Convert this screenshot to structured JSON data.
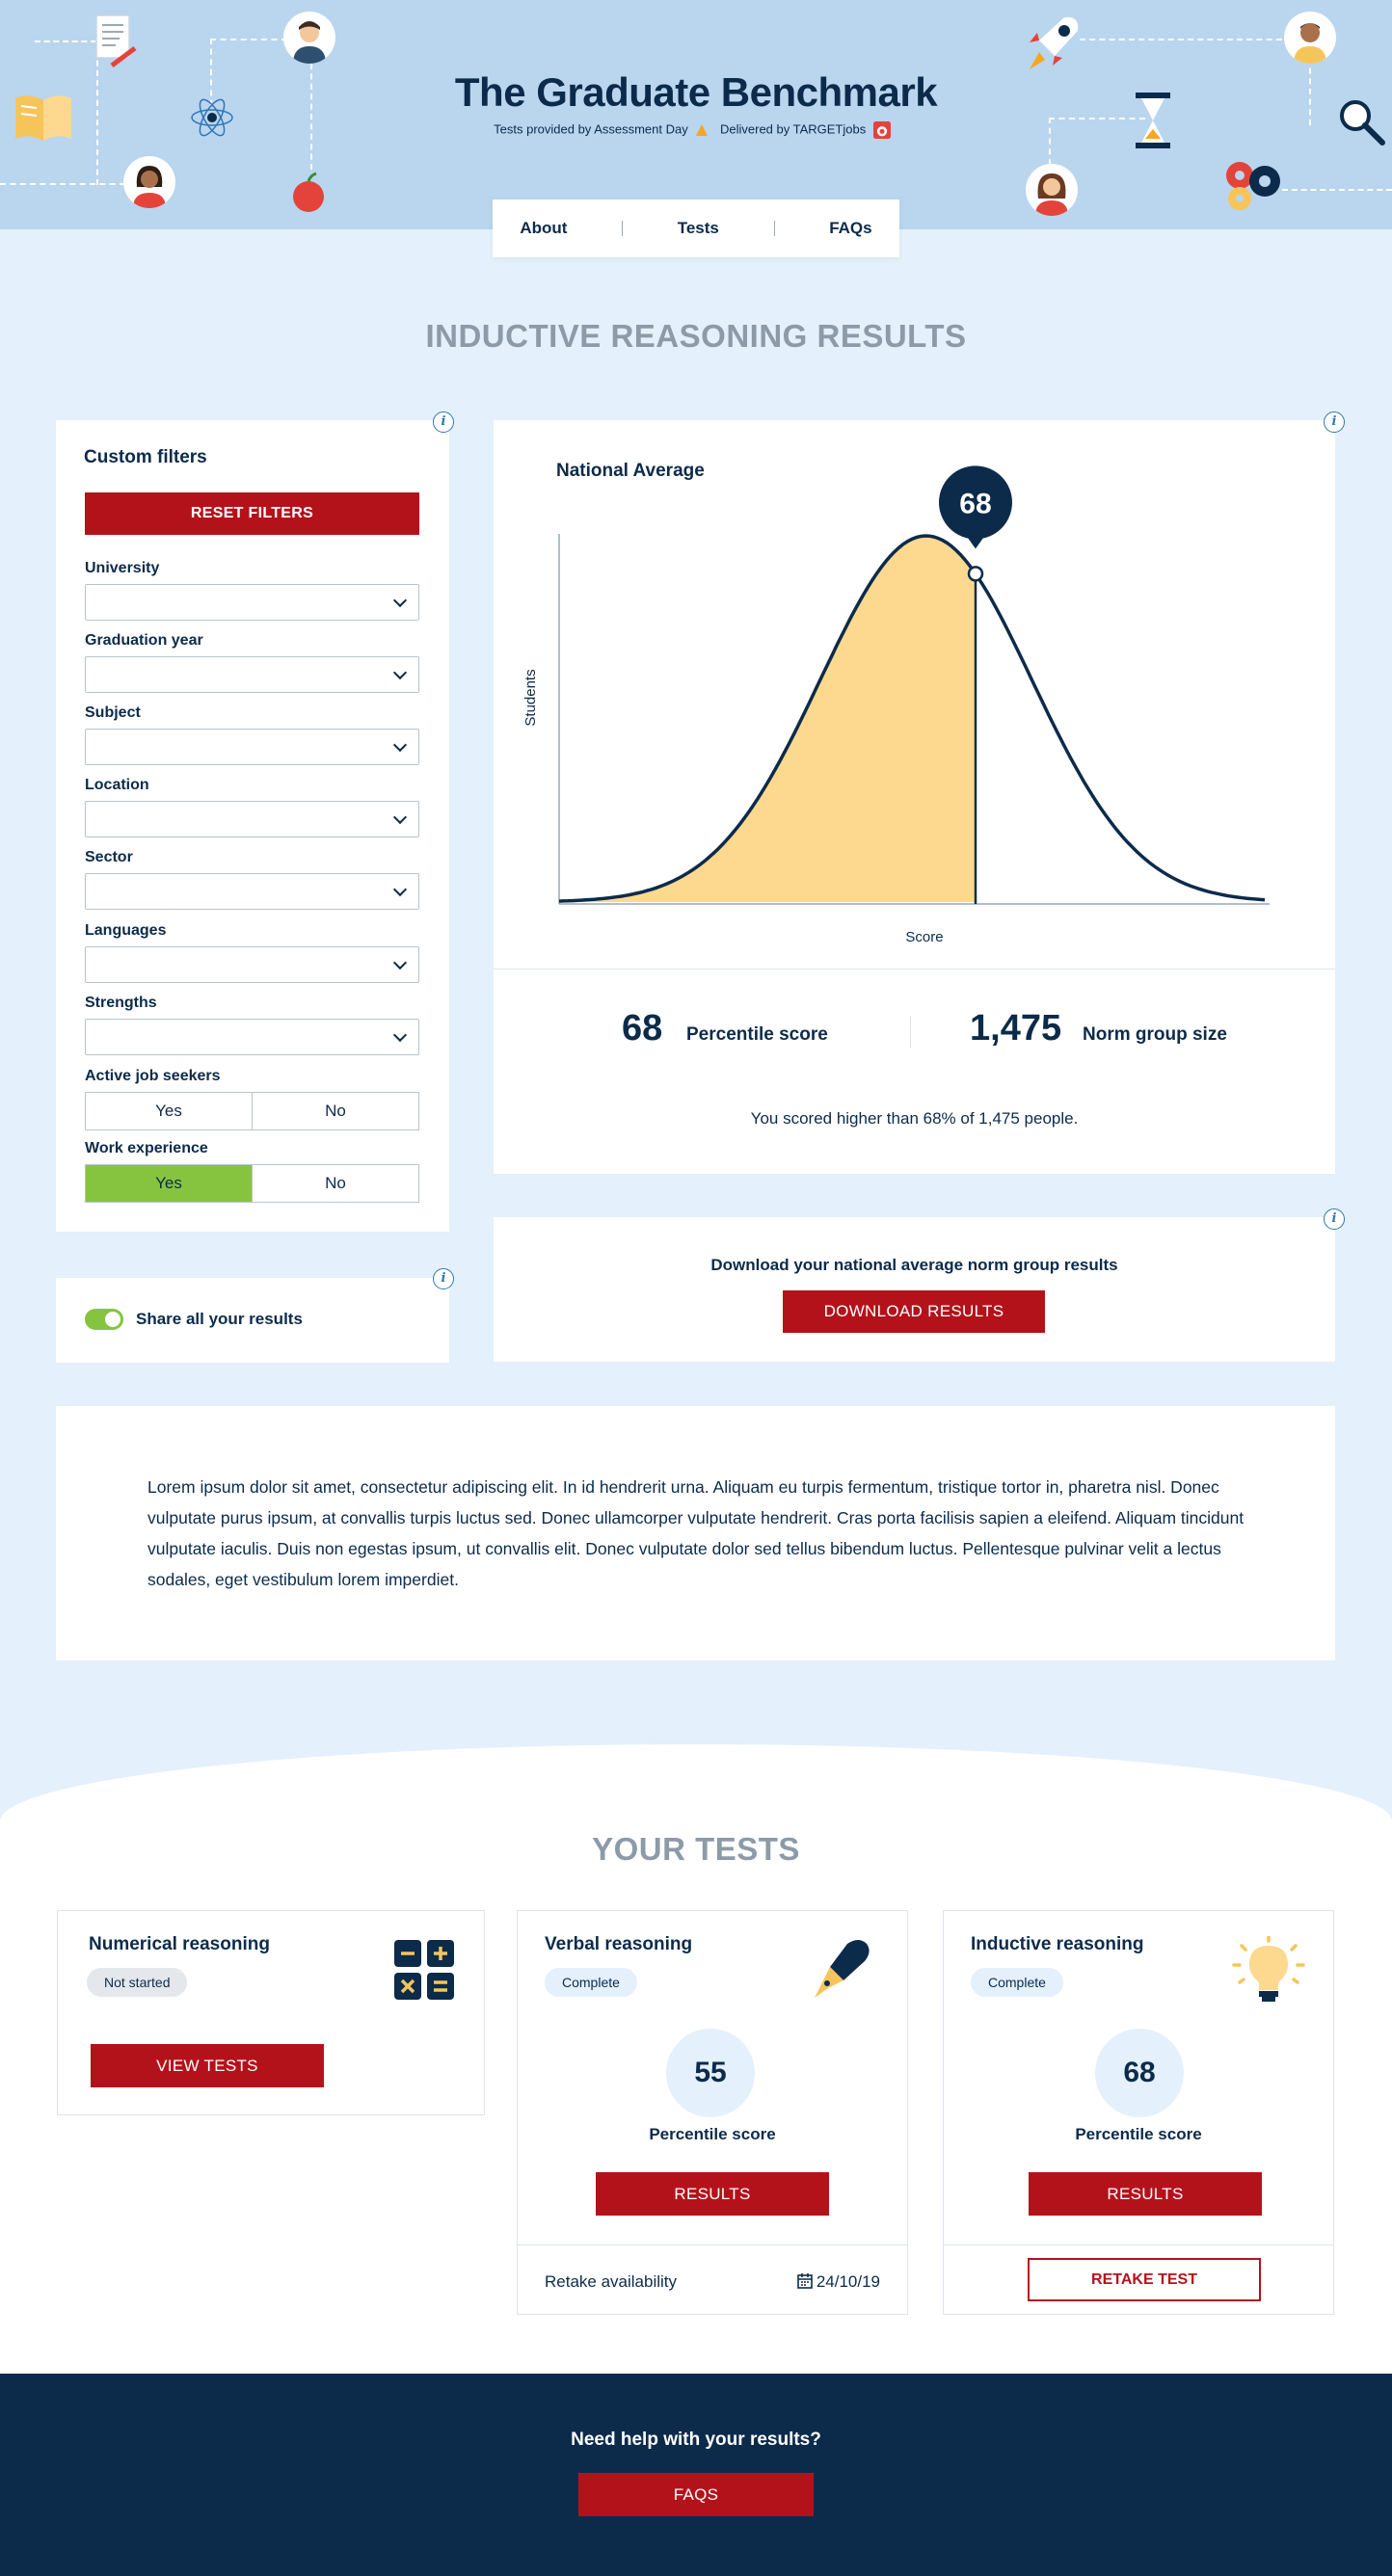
{
  "header": {
    "title": "The Graduate Benchmark",
    "sub_provided": "Tests provided by Assessment Day",
    "sub_delivered": "Delivered by TARGETjobs"
  },
  "nav": {
    "items": [
      "About",
      "Tests",
      "FAQs"
    ]
  },
  "page_title": "INDUCTIVE REASONING RESULTS",
  "filters": {
    "title": "Custom filters",
    "reset_label": "RESET FILTERS",
    "fields": [
      "University",
      "Graduation year",
      "Subject",
      "Location",
      "Sector",
      "Languages",
      "Strengths"
    ],
    "active_job_seekers": {
      "label": "Active job seekers",
      "yes": "Yes",
      "no": "No",
      "selected": ""
    },
    "work_experience": {
      "label": "Work experience",
      "yes": "Yes",
      "no": "No",
      "selected": "Yes"
    }
  },
  "share": {
    "label": "Share all your results",
    "enabled": true
  },
  "chart": {
    "title": "National Average",
    "xlabel": "Score",
    "ylabel": "Students",
    "marker_value": "68",
    "percentile_value": "68",
    "percentile_label": "Percentile score",
    "norm_value": "1,475",
    "norm_label": "Norm group size",
    "summary": "You scored higher than 68% of 1,475 people."
  },
  "chart_data": {
    "type": "area",
    "title": "National Average",
    "xlabel": "Score",
    "ylabel": "Students",
    "distribution": "normal",
    "marker": 68,
    "series": [
      {
        "values": []
      }
    ],
    "colors": {
      "fill": "#fcd98e",
      "line": "#0c2b4b"
    }
  },
  "download": {
    "text": "Download your national average norm group results",
    "button": "DOWNLOAD RESULTS"
  },
  "lorem": "Lorem ipsum dolor sit amet, consectetur adipiscing elit. In id hendrerit urna. Aliquam eu turpis fermentum, tristique tortor in, pharetra nisl. Donec vulputate purus ipsum, at convallis turpis luctus sed. Donec ullamcorper vulputate hendrerit. Cras porta facilisis sapien a eleifend. Aliquam tincidunt vulputate iaculis. Duis non egestas ipsum, ut convallis elit. Donec vulputate dolor sed tellus bibendum luctus. Pellentesque pulvinar velit a lectus sodales, eget vestibulum lorem imperdiet.",
  "tests_title": "YOUR TESTS",
  "tests": {
    "numerical": {
      "title": "Numerical reasoning",
      "status": "Not started",
      "button": "VIEW TESTS",
      "icon": "calculator-icon"
    },
    "verbal": {
      "title": "Verbal reasoning",
      "status": "Complete",
      "score": "55",
      "score_label": "Percentile score",
      "button": "RESULTS",
      "retake_label": "Retake availability",
      "retake_date": "24/10/19",
      "icon": "fountain-pen-icon"
    },
    "inductive": {
      "title": "Inductive reasoning",
      "status": "Complete",
      "score": "68",
      "score_label": "Percentile score",
      "button": "RESULTS",
      "retake_button": "RETAKE TEST",
      "icon": "lightbulb-icon"
    }
  },
  "footer": {
    "question": "Need help with your results?",
    "button": "FAQS"
  },
  "colors": {
    "navy": "#0c2b4b",
    "red": "#b4121b",
    "green": "#86c440",
    "sky": "#bad5ee",
    "pale": "#e4f0fb",
    "curve_fill": "#fcd98e"
  }
}
